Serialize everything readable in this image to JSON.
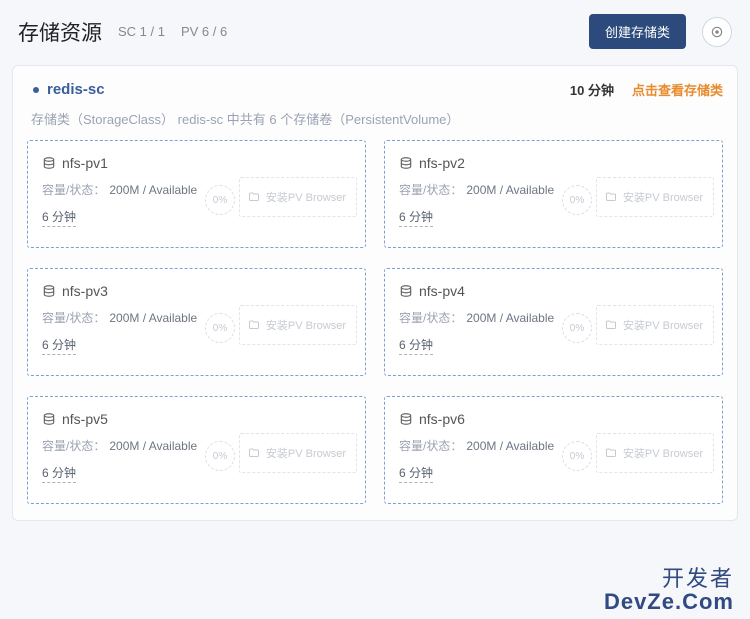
{
  "header": {
    "title": "存储资源",
    "sc_stat": "SC 1 / 1",
    "pv_stat": "PV 6 / 6",
    "create_btn": "创建存储类"
  },
  "panel": {
    "sc_name": "redis-sc",
    "age": "10 分钟",
    "link": "点击查看存储类",
    "subdesc": "存储类（StorageClass） redis-sc 中共有 6 个存储卷（PersistentVolume）"
  },
  "pv_labels": {
    "capacity_status": "容量/状态：",
    "pct": "0%",
    "install": "安装PV Browser"
  },
  "pvs": [
    {
      "name": "nfs-pv1",
      "capstat": "200M / Available",
      "age": "6 分钟"
    },
    {
      "name": "nfs-pv2",
      "capstat": "200M / Available",
      "age": "6 分钟"
    },
    {
      "name": "nfs-pv3",
      "capstat": "200M / Available",
      "age": "6 分钟"
    },
    {
      "name": "nfs-pv4",
      "capstat": "200M / Available",
      "age": "6 分钟"
    },
    {
      "name": "nfs-pv5",
      "capstat": "200M / Available",
      "age": "6 分钟"
    },
    {
      "name": "nfs-pv6",
      "capstat": "200M / Available",
      "age": "6 分钟"
    }
  ],
  "watermark": {
    "line1": "开发者",
    "line2": "DevZe.Com"
  }
}
